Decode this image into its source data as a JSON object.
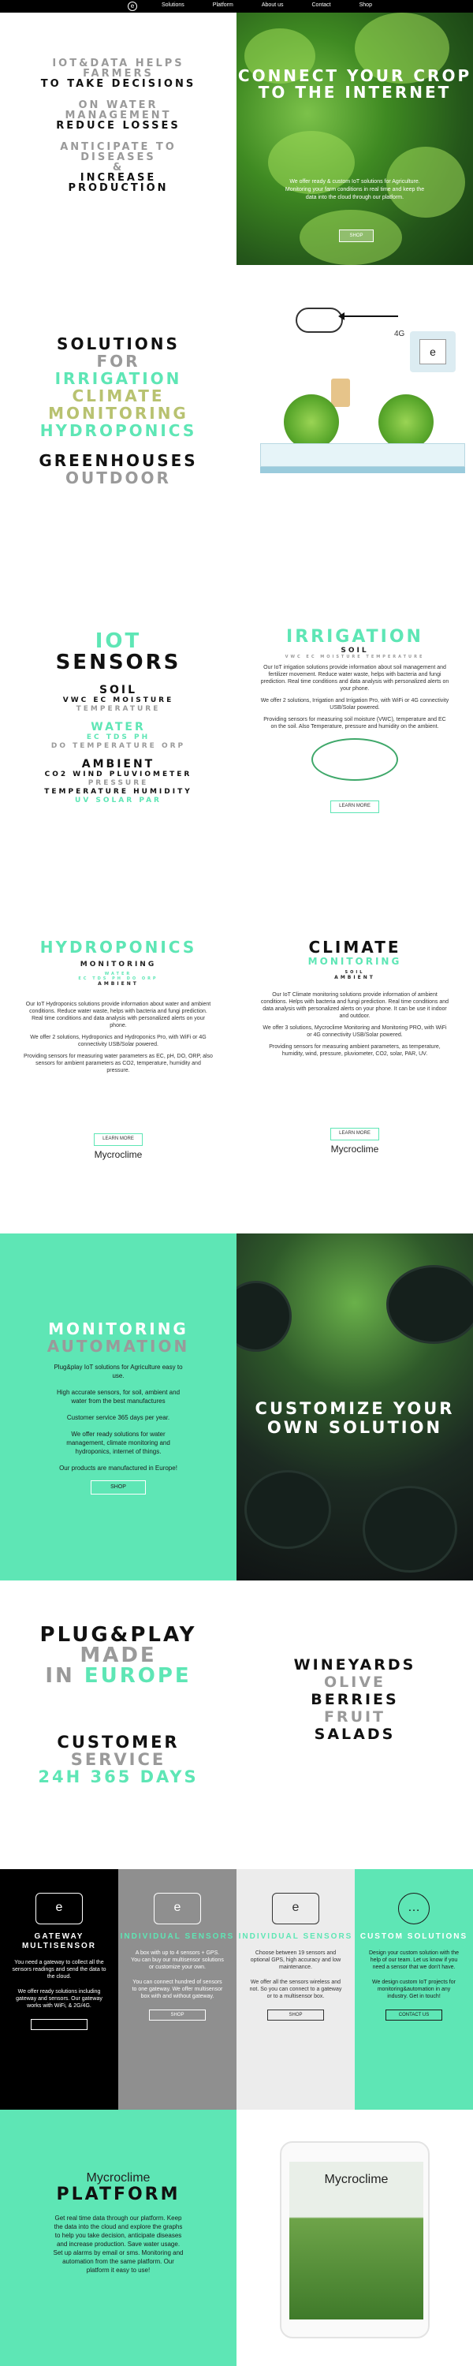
{
  "nav": {
    "logo": "e",
    "links": [
      "Solutions",
      "Platform",
      "About us",
      "Contact",
      "Shop"
    ]
  },
  "s1": {
    "lines": [
      {
        "text": "IOT&DATA HELPS",
        "color": "gray"
      },
      {
        "text": "FARMERS",
        "color": "gray"
      },
      {
        "text": "TO TAKE DECISIONS",
        "color": "black"
      },
      {
        "text": "ON WATER",
        "color": "gray"
      },
      {
        "text": "MANAGEMENT",
        "color": "gray"
      },
      {
        "text": "REDUCE LOSSES",
        "color": "black"
      },
      {
        "text": "ANTICIPATE TO",
        "color": "gray"
      },
      {
        "text": "DISEASES",
        "color": "gray"
      },
      {
        "text": "&",
        "color": "gray"
      },
      {
        "text": "INCREASE",
        "color": "black"
      },
      {
        "text": "PRODUCTION",
        "color": "black"
      }
    ],
    "hero_title": "CONNECT YOUR CROP TO THE INTERNET",
    "hero_text": "We offer ready & custom IoT solutions for Agriculture. Monitoring your farm conditions in real time and keep the data into the cloud through our platform.",
    "hero_button": "SHOP"
  },
  "s2": {
    "lines": [
      {
        "text": "SOLUTIONS",
        "color": "black"
      },
      {
        "text": "FOR",
        "color": "gray"
      },
      {
        "text": "IRRIGATION",
        "color": "mint"
      },
      {
        "text": "CLIMATE",
        "color": "olive"
      },
      {
        "text": "MONITORING",
        "color": "olive"
      },
      {
        "text": "HYDROPONICS",
        "color": "mint"
      },
      {
        "text": "",
        "color": "gray"
      },
      {
        "text": "GREENHOUSES",
        "color": "black"
      },
      {
        "text": "OUTDOOR",
        "color": "gray"
      }
    ],
    "label_4g": "4G",
    "device_logo": "e"
  },
  "s3": {
    "iot_title1": "IOT",
    "iot_title2": "SENSORS",
    "soil": "SOIL",
    "soil_vars": "VWC EC MOISTURE",
    "soil_temp": "TEMPERATURE",
    "water": "WATER",
    "water_vars": "EC TDS PH",
    "water_vars2": "DO TEMPERATURE ORP",
    "ambient": "AMBIENT",
    "ambient_vars": "CO2 WIND PLUVIOMETER",
    "ambient_vars2": "PRESSURE",
    "ambient_vars3": "TEMPERATURE HUMIDITY",
    "ambient_vars4": "UV SOLAR PAR",
    "irrigation_title": "IRRIGATION",
    "irrigation_soil": "SOIL",
    "irrigation_soil_vars": "VWC EC MOISTURE TEMPERATURE",
    "irrigation_p1": "Our IoT irrigation solutions provide information about soil management and fertilizer movement. Reduce water waste, helps with bacteria and fungi prediction. Real time conditions and data analysis with personalized alerts on your phone.",
    "irrigation_p2": "We offer 2 solutions, Irrigation and Irrigation Pro, with WiFi or 4G connectivity USB/Solar powered.",
    "irrigation_p3": "Providing sensors for measuring soil moisture (VWC), temperature and EC on the soil. Also Temperature, pressure and humidity on the ambient.",
    "irrigation_button": "LEARN MORE"
  },
  "s4": {
    "hydro_title": "HYDROPONICS",
    "hydro_sub": "MONITORING",
    "hydro_water": "WATER",
    "hydro_water_vars": "EC TDS PH DO ORP",
    "hydro_ambient": "AMBIENT",
    "hydro_p1": "Our IoT Hydroponics solutions provide information about water and ambient conditions. Reduce water waste, helps with bacteria and fungi prediction. Real time conditions and data analysis with personalized alerts on your phone.",
    "hydro_p2": "We offer 2 solutions, Hydroponics and Hydroponics Pro, with WiFi or 4G connectivity USB/Solar powered.",
    "hydro_p3": "Providing sensors for measuring water parameters as EC, pH, DO, ORP, also sensors for ambient parameters as CO2, temperature, humidity and pressure.",
    "hydro_button": "LEARN MORE",
    "climate_title": "CLIMATE",
    "climate_sub": "MONITORING",
    "climate_soil": "SOIL",
    "climate_ambient": "AMBIENT",
    "climate_p1": "Our IoT Climate monitoring solutions provide information of ambient conditions. Helps with bacteria and fungi prediction. Real time conditions and data analysis with personalized alerts on your phone. It can be use it indoor and outdoor.",
    "climate_p2": "We offer 3 solutions, Mycroclime Monitoring and Monitoring PRO, with WiFi or 4G connectivity USB/Solar powered.",
    "climate_p3": "Providing sensors for measuring ambient parameters, as temperature, humidity, wind, pressure, pluviometer, CO2, solar, PAR, UV.",
    "climate_button": "LEARN MORE",
    "brand": "Mycroclime"
  },
  "s5": {
    "title1": "MONITORING",
    "title2": "AUTOMATION",
    "p1": "Plug&play IoT solutions for Agriculture easy to use.",
    "p2": "High accurate sensors, for soil, ambient and water from the best manufactures",
    "p3": "Customer service 365 days per year.",
    "p4": "We offer ready solutions for water management, climate monitoring and hydroponics, internet of things.",
    "p5": "Our products are manufactured in Europe!",
    "button": "SHOP",
    "right_title": "CUSTOMIZE YOUR OWN SOLUTION"
  },
  "s6": {
    "l1": "PLUG&PLAY",
    "l2": "MADE",
    "l3a": "IN",
    "l3b": "EUROPE",
    "l4": "CUSTOMER",
    "l5": "SERVICE",
    "l6": "24H 365 DAYS",
    "right": [
      {
        "text": "WINEYARDS",
        "color": "black"
      },
      {
        "text": "OLIVE",
        "color": "gray"
      },
      {
        "text": "BERRIES",
        "color": "black"
      },
      {
        "text": "FRUIT",
        "color": "gray"
      },
      {
        "text": "SALADS",
        "color": "black"
      }
    ]
  },
  "cards": [
    {
      "title": "GATEWAY MULTISENSOR",
      "icon": "e",
      "p1": "You need a gateway to collect all the sensors readings and send the data to the cloud.",
      "p2": "We offer ready solutions including gateway and sensors. Our gateway works with WiFi, & 2G/4G.",
      "button": "",
      "bg": "#000000",
      "fg": "#ffffff"
    },
    {
      "title": "INDIVIDUAL SENSORS",
      "icon": "e",
      "p1": "A box with up to 4 sensors + GPS. You can buy our multisensor solutions or customize your own.",
      "p2": "You can connect hundred of sensors to one gateway. We offer multisensor box with and without gateway.",
      "button": "SHOP",
      "bg": "#8f8f8f",
      "fg": "#ffffff"
    },
    {
      "title": "INDIVIDUAL SENSORS",
      "icon": "e",
      "p1": "Choose between 19 sensors and optional GPS, high accuracy and low maintenance.",
      "p2": "We offer all the sensors wireless and not. So you can connect to a gateway or to a multisensor box.",
      "button": "SHOP",
      "bg": "#ececec",
      "fg": "#333333"
    },
    {
      "title": "CUSTOM SOLUTIONS",
      "icon": "…",
      "p1": "Design your custom solution with the help of our team. Let us know if you need a sensor that we don't have.",
      "p2": "We design custom IoT projects for monitoring&automation in any industry. Get in touch!",
      "button": "CONTACT US",
      "bg": "#5ee6b5",
      "fg": "#1a1a1a"
    }
  ],
  "s8": {
    "brand": "Mycroclime",
    "title": "PLATFORM",
    "text": "Get real time data through our platform. Keep the data into the cloud and explore the graphs to help you take decision, anticipate diseases and increase production. Save water usage. Set up alarms by email or sms. Monitoring and automation from the same platform. Our platform it easy to use!",
    "tablet_brand": "Mycroclime"
  }
}
